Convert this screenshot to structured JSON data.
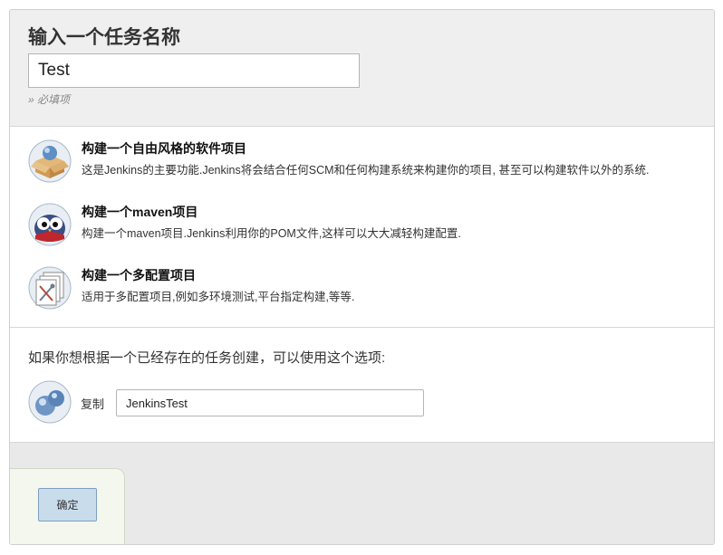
{
  "header": {
    "title": "输入一个任务名称",
    "name_value": "Test",
    "required_note": "» 必填项"
  },
  "job_types": [
    {
      "icon": "freestyle-box-icon",
      "title": "构建一个自由风格的软件项目",
      "description": "这是Jenkins的主要功能.Jenkins将会结合任何SCM和任何构建系统来构建你的项目, 甚至可以构建软件以外的系统."
    },
    {
      "icon": "maven-owl-icon",
      "title": "构建一个maven项目",
      "description": "构建一个maven项目.Jenkins利用你的POM文件,这样可以大大减轻构建配置."
    },
    {
      "icon": "multi-config-icon",
      "title": "构建一个多配置项目",
      "description": "适用于多配置项目,例如多环境测试,平台指定构建,等等."
    }
  ],
  "copy": {
    "heading": "如果你想根据一个已经存在的任务创建，可以使用这个选项:",
    "label": "复制",
    "value": "JenkinsTest",
    "icon": "copy-spheres-icon"
  },
  "footer": {
    "ok_label": "确定"
  },
  "colors": {
    "header_bg": "#efefef",
    "footer_bg": "#e9e9e9",
    "button_bg": "#c9dcec"
  }
}
